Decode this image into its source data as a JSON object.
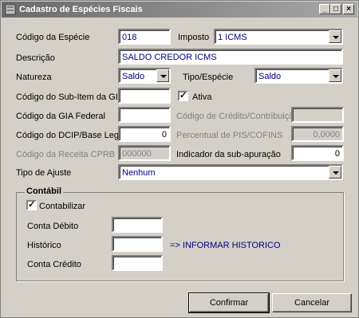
{
  "window": {
    "title": "Cadastro de Espécies Fiscais",
    "controls": {
      "minimize": "_",
      "maximize": "□",
      "close": "×"
    }
  },
  "form": {
    "codigo_especie": {
      "label": "Código da Espécie",
      "value": "018"
    },
    "imposto": {
      "label": "Imposto",
      "value": "1 ICMS"
    },
    "descricao": {
      "label": "Descrição",
      "value": "SALDO CREDOR ICMS"
    },
    "natureza": {
      "label": "Natureza",
      "value": "Saldo"
    },
    "tipo_especie": {
      "label": "Tipo/Espécie",
      "value": "Saldo"
    },
    "sub_item_gia": {
      "label": "Código do Sub-Item da GIA",
      "value": ""
    },
    "ativa": {
      "label": "Ativa",
      "checked": true,
      "mark": "✓"
    },
    "gia_federal": {
      "label": "Código da GIA Federal",
      "value": ""
    },
    "credito_contribuicao": {
      "label": "Código de Crédito/Contribuição",
      "value": ""
    },
    "dcip": {
      "label": "Código do DCIP/Base Legal",
      "value": "0"
    },
    "pis_cofins": {
      "label": "Percentual de PIS/COFINS",
      "value": "0,0000"
    },
    "receita_cprb": {
      "label": "Código da Receita CPRB",
      "value": "000000"
    },
    "sub_apuracao": {
      "label": "Indicador da sub-apuração",
      "value": "0"
    },
    "tipo_ajuste": {
      "label": "Tipo de Ajuste",
      "value": "Nenhum"
    }
  },
  "contabil": {
    "title": "Contábil",
    "contabilizar": {
      "label": "Contabilizar",
      "checked": true,
      "mark": "✓"
    },
    "conta_debito": {
      "label": "Conta Débito",
      "value": ""
    },
    "historico": {
      "label": "Histórico",
      "value": "",
      "hint": "=> INFORMAR HISTORICO"
    },
    "conta_credito": {
      "label": "Conta Crédito",
      "value": ""
    }
  },
  "buttons": {
    "confirmar": "Confirmar",
    "cancelar": "Cancelar"
  }
}
